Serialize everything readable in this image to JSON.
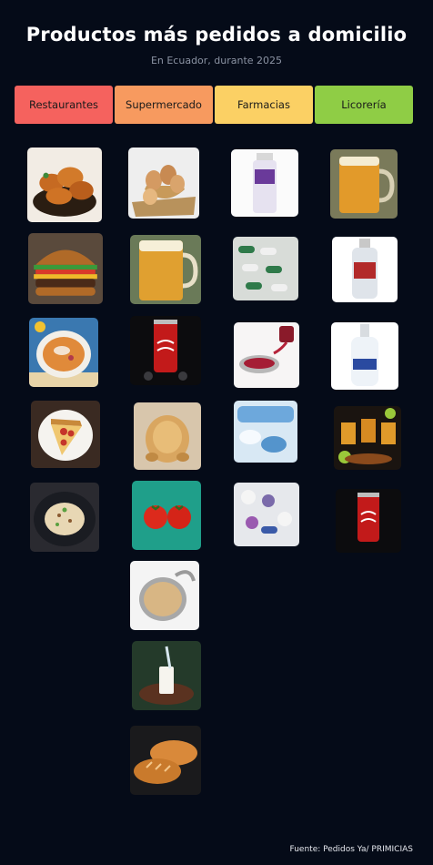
{
  "header": {
    "title": "Productos más pedidos a domicilio",
    "subtitle": "En Ecuador, durante 2025"
  },
  "categories": {
    "restaurantes": "Restaurantes",
    "supermercado": "Supermercado",
    "farmacias": "Farmacias",
    "licoreria": "Licorería"
  },
  "colors": {
    "background": "#050b18",
    "restaurantes": "#f5625e",
    "supermercado": "#f79a5f",
    "farmacias": "#fbd064",
    "licoreria": "#8fcd45"
  },
  "products": {
    "restaurantes": [
      "fried-chicken-icon",
      "burger-icon",
      "ceviche-soup-icon",
      "pizza-slice-icon",
      "rice-dish-icon"
    ],
    "supermercado": [
      "eggs-icon",
      "beer-icon",
      "cola-can-icon",
      "roast-chicken-icon",
      "tomatoes-icon",
      "canned-tuna-icon",
      "milk-glass-icon",
      "bread-icon"
    ],
    "farmacias": [
      "syrup-bottle-icon",
      "capsules-icon",
      "syrup-spoon-icon",
      "tablets-blister-icon",
      "mixed-pills-icon"
    ],
    "licoreria": [
      "beer-mug-icon",
      "aguardiente-bottle-icon",
      "vodka-bottle-icon",
      "tequila-shots-icon",
      "cola-can-icon"
    ]
  },
  "footer": {
    "source": "Fuente: Pedidos Ya/ PRIMICIAS"
  }
}
